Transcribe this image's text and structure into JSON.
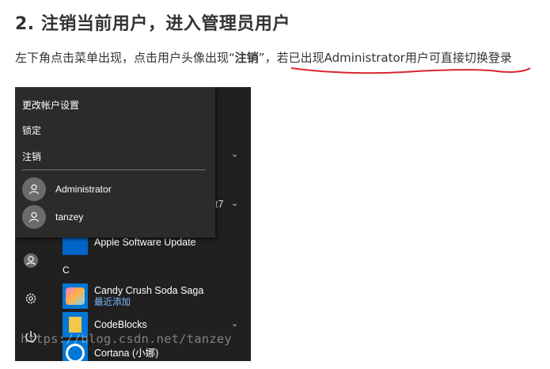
{
  "heading": "2. 注销当前用户，进入管理员用户",
  "paragraph": {
    "part1": "左下角点击菜单出现，点击用户头像出现“",
    "bold": "注销",
    "part2": "”，",
    "part3": "若已出现Administrator用户可直接切换登录"
  },
  "colors": {
    "underline": "#d9262c",
    "accent_link": "#7fb9ff"
  },
  "popup": {
    "items": [
      "更改帐户设置",
      "锁定",
      "注销"
    ],
    "users": [
      "Administrator",
      "tanzey"
    ]
  },
  "start_menu": {
    "partial_label": "t7",
    "letter": "C",
    "apps": [
      {
        "name": "Apple Software Update",
        "sub": ""
      },
      {
        "name": "Candy Crush Soda Saga",
        "sub": "最近添加"
      },
      {
        "name": "CodeBlocks",
        "sub": ""
      },
      {
        "name": "Cortana (小娜)",
        "sub": ""
      }
    ]
  },
  "icons": [
    "user-avatar-icon",
    "gear-icon",
    "power-icon",
    "chevron-down-icon"
  ],
  "watermark": "https://blog.csdn.net/tanzey"
}
